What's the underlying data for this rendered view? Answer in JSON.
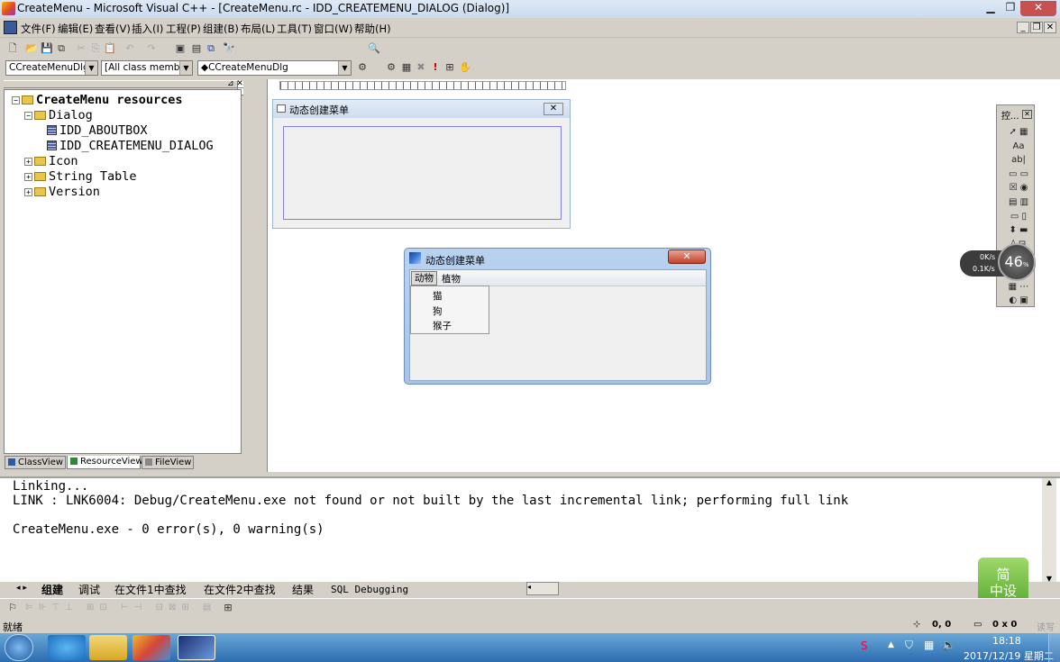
{
  "window": {
    "title": "CreateMenu - Microsoft Visual C++ - [CreateMenu.rc - IDD_CREATEMENU_DIALOG (Dialog)]",
    "min": "▁",
    "max": "❐",
    "close": "✕"
  },
  "menu": {
    "items": [
      "文件(F)",
      "编辑(E)",
      "查看(V)",
      "插入(I)",
      "工程(P)",
      "组建(B)",
      "布局(L)",
      "工具(T)",
      "窗口(W)",
      "帮助(H)"
    ]
  },
  "toolbar2": {
    "class_combo": "CCreateMenuDlg",
    "filter_combo": "[All class members",
    "member_combo": "◆CCreateMenuDlg"
  },
  "workspace": {
    "root": "CreateMenu resources",
    "dialog_folder": "Dialog",
    "dialogs": [
      "IDD_ABOUTBOX",
      "IDD_CREATEMENU_DIALOG"
    ],
    "folders": [
      "Icon",
      "String Table",
      "Version"
    ],
    "tabs": [
      "ClassView",
      "ResourceView",
      "FileView"
    ]
  },
  "design_dialog": {
    "title": "动态创建菜单"
  },
  "running_dialog": {
    "title": "动态创建菜单",
    "menubar": [
      "动物",
      "植物"
    ],
    "dropdown": [
      "猫",
      "狗",
      "猴子"
    ],
    "close": "✕"
  },
  "toolbox": {
    "title": "控...",
    "close": "✕"
  },
  "netmon": {
    "up": "0K/s",
    "down": "0.1K/s",
    "percent": "46",
    "unit": "%"
  },
  "output": {
    "lines": [
      "Linking...",
      "LINK : LNK6004: Debug/CreateMenu.exe not found or not built by the last incremental link; performing full link",
      "",
      "CreateMenu.exe - 0 error(s), 0 warning(s)"
    ],
    "tabs": [
      "组建",
      "调试",
      "在文件1中查找",
      "在文件2中查找",
      "结果",
      "SQL Debugging"
    ]
  },
  "badge": {
    "text": "简\n中设"
  },
  "status": {
    "text": "就绪",
    "pos": "0, 0",
    "size": "0 x 0",
    "mode": "读写"
  },
  "taskbar": {
    "time": "18:18",
    "date": "2017/12/19 星期二"
  }
}
